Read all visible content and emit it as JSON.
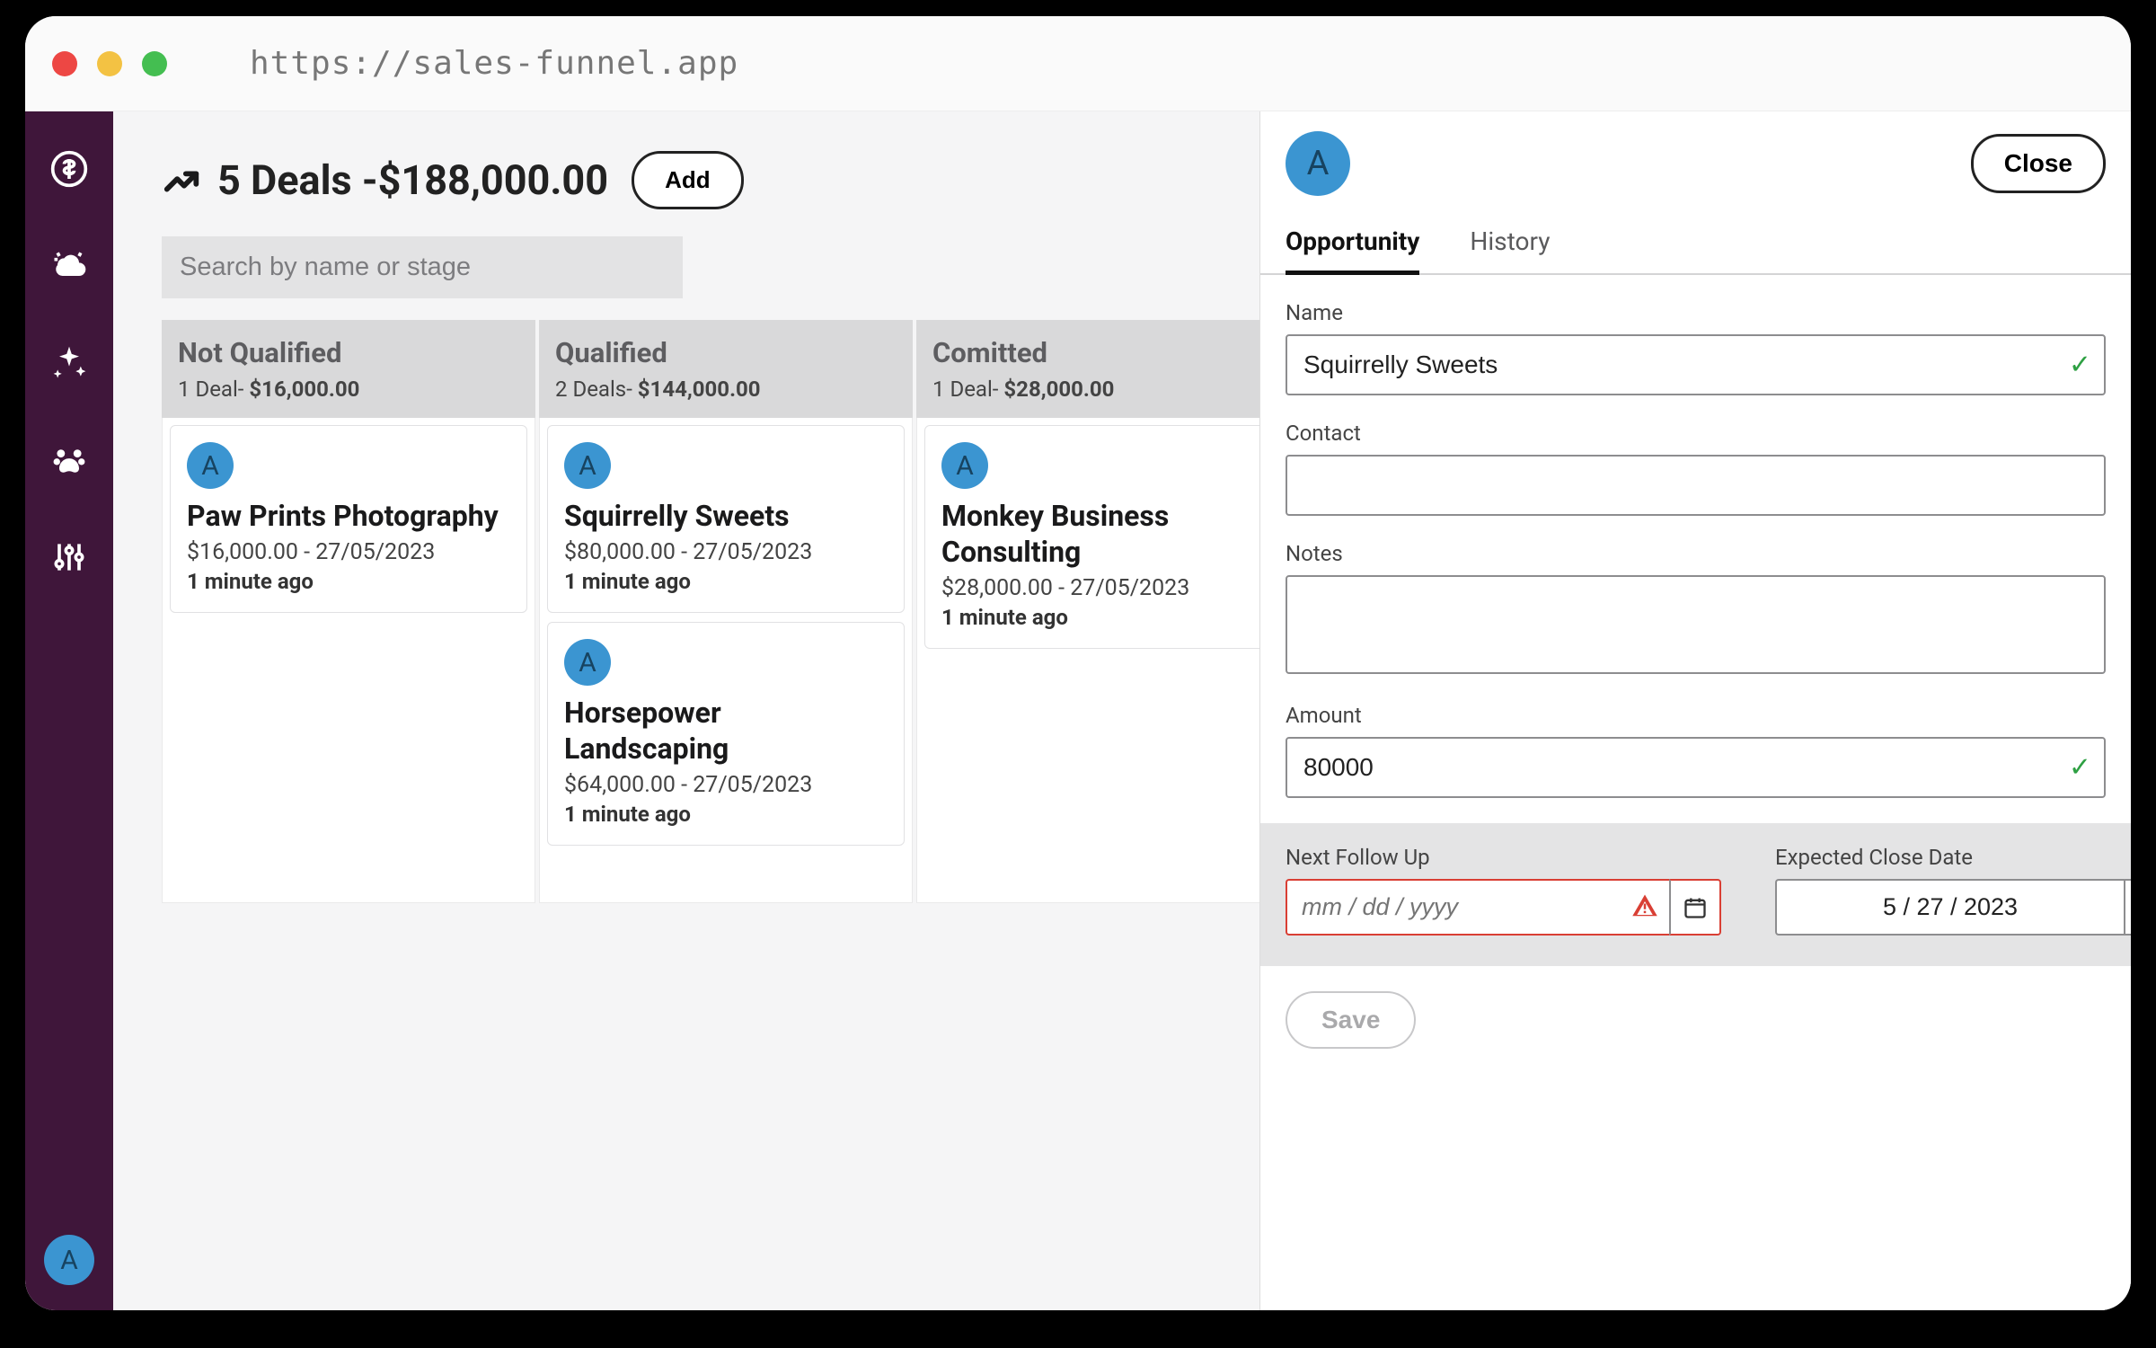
{
  "browser": {
    "url": "https://sales-funnel.app"
  },
  "header": {
    "title": "5 Deals -$188,000.00",
    "add_label": "Add"
  },
  "search": {
    "placeholder": "Search by name or stage"
  },
  "kanban": {
    "columns": [
      {
        "stage": "Not Qualified",
        "sub_count": "1 Deal- ",
        "sub_amount": "$16,000.00",
        "cards": [
          {
            "avatar": "A",
            "title": "Paw Prints Photography",
            "meta": "$16,000.00 - 27/05/2023",
            "time": "1 minute ago"
          }
        ]
      },
      {
        "stage": "Qualified",
        "sub_count": "2 Deals- ",
        "sub_amount": "$144,000.00",
        "cards": [
          {
            "avatar": "A",
            "title": "Squirrelly Sweets",
            "meta": "$80,000.00 - 27/05/2023",
            "time": "1 minute ago"
          },
          {
            "avatar": "A",
            "title": "Horsepower Landscaping",
            "meta": "$64,000.00 - 27/05/2023",
            "time": "1 minute ago"
          }
        ]
      },
      {
        "stage": "Comitted",
        "sub_count": "1 Deal- ",
        "sub_amount": "$28,000.00",
        "cards": [
          {
            "avatar": "A",
            "title": "Monkey Business Consulting",
            "meta": "$28,000.00 - 27/05/2023",
            "time": "1 minute ago"
          }
        ]
      }
    ]
  },
  "panel": {
    "avatar": "A",
    "close_label": "Close",
    "tabs": {
      "opportunity": "Opportunity",
      "history": "History"
    },
    "form": {
      "name_label": "Name",
      "name_value": "Squirrelly Sweets",
      "contact_label": "Contact",
      "contact_value": "",
      "notes_label": "Notes",
      "notes_value": "",
      "amount_label": "Amount",
      "amount_value": "80000",
      "followup_label": "Next Follow Up",
      "followup_placeholder": "mm / dd / yyyy",
      "close_date_label": "Expected Close Date",
      "close_date_value": "5 / 27 / 2023",
      "save_label": "Save"
    }
  },
  "sidebar": {
    "avatar": "A"
  }
}
